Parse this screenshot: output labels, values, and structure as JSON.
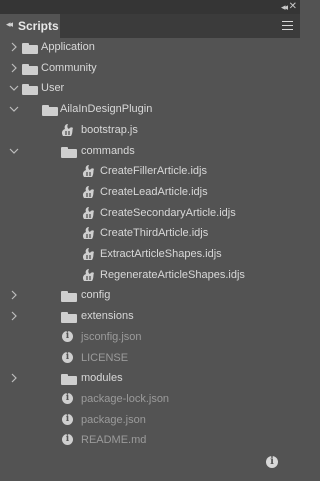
{
  "panel": {
    "tab_label": "Scripts",
    "collapse_glyph": "◂◂",
    "close_glyph": "✕",
    "tab_close_glyph": "×"
  },
  "tree": {
    "rows": [
      {
        "label": "Application",
        "type": "folder",
        "depth": 0,
        "chevron": "right",
        "dim": false
      },
      {
        "label": "Community",
        "type": "folder",
        "depth": 0,
        "chevron": "right",
        "dim": false
      },
      {
        "label": "User",
        "type": "folder",
        "depth": 0,
        "chevron": "down",
        "dim": false
      },
      {
        "label": "AilaInDesignPlugin",
        "type": "folder",
        "depth": 1,
        "chevron": "down",
        "dim": false
      },
      {
        "label": "bootstrap.js",
        "type": "script",
        "depth": 2,
        "chevron": "none",
        "dim": false
      },
      {
        "label": "commands",
        "type": "folder",
        "depth": 2,
        "chevron": "down",
        "dim": false
      },
      {
        "label": "CreateFillerArticle.idjs",
        "type": "script",
        "depth": 3,
        "chevron": "none",
        "dim": false
      },
      {
        "label": "CreateLeadArticle.idjs",
        "type": "script",
        "depth": 3,
        "chevron": "none",
        "dim": false
      },
      {
        "label": "CreateSecondaryArticle.idjs",
        "type": "script",
        "depth": 3,
        "chevron": "none",
        "dim": false
      },
      {
        "label": "CreateThirdArticle.idjs",
        "type": "script",
        "depth": 3,
        "chevron": "none",
        "dim": false
      },
      {
        "label": "ExtractArticleShapes.idjs",
        "type": "script",
        "depth": 3,
        "chevron": "none",
        "dim": false
      },
      {
        "label": "RegenerateArticleShapes.idjs",
        "type": "script",
        "depth": 3,
        "chevron": "none",
        "dim": false
      },
      {
        "label": "config",
        "type": "folder",
        "depth": 2,
        "chevron": "right",
        "dim": false
      },
      {
        "label": "extensions",
        "type": "folder",
        "depth": 2,
        "chevron": "right",
        "dim": false
      },
      {
        "label": "jsconfig.json",
        "type": "info",
        "depth": 2,
        "chevron": "none",
        "dim": true
      },
      {
        "label": "LICENSE",
        "type": "info",
        "depth": 2,
        "chevron": "none",
        "dim": true
      },
      {
        "label": "modules",
        "type": "folder",
        "depth": 2,
        "chevron": "right",
        "dim": false
      },
      {
        "label": "package-lock.json",
        "type": "info",
        "depth": 2,
        "chevron": "none",
        "dim": true
      },
      {
        "label": "package.json",
        "type": "info",
        "depth": 2,
        "chevron": "none",
        "dim": true
      },
      {
        "label": "README.md",
        "type": "info",
        "depth": 2,
        "chevron": "none",
        "dim": true
      }
    ]
  },
  "icons": {
    "chevron_right": "chevron-right-icon",
    "chevron_down": "chevron-down-icon",
    "folder": "folder-icon",
    "script": "script-file-icon",
    "info": "info-icon",
    "menu": "panel-menu-icon"
  },
  "colors": {
    "panel_bg": "#535353",
    "tabbar_bg": "#3b3b3b",
    "text": "#d8d8d8",
    "dim_text": "#9b9b9b"
  }
}
